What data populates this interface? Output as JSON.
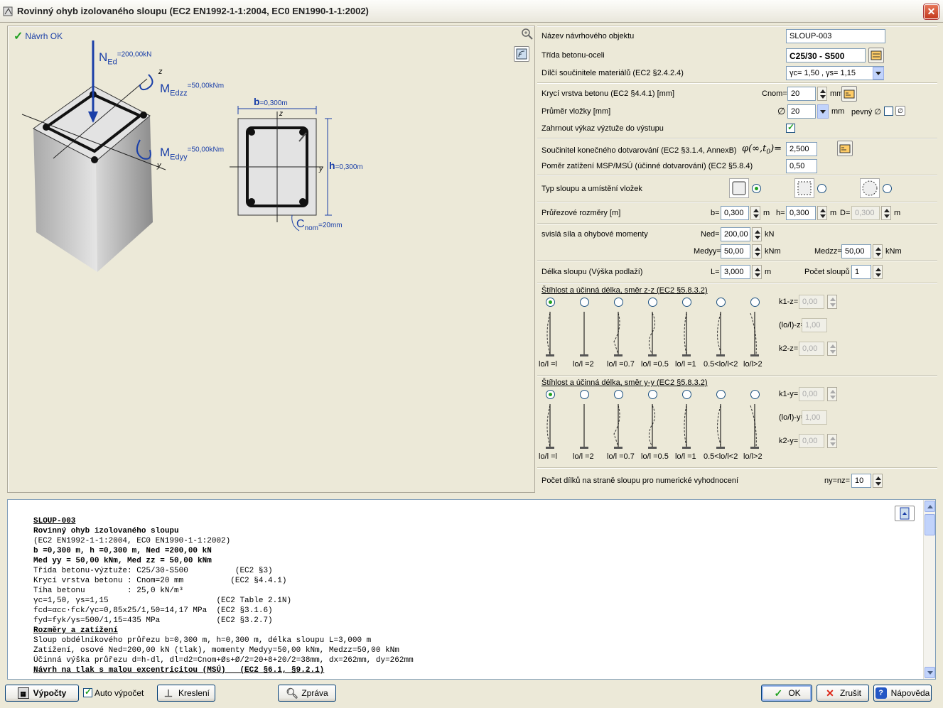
{
  "window": {
    "title": "Rovinný ohyb izolovaného sloupu (EC2 EN1992-1-1:2004, EC0 EN1990-1-1:2002)",
    "close": "✕"
  },
  "drawing": {
    "status": "Návrh OK",
    "ned_label": "N",
    "ned_sub": "Ed",
    "ned_val": "=200,00kN",
    "medzz_label": "M",
    "medzz_sub": "Edzz",
    "medzz_val": "=50,00kNm",
    "medyy_label": "M",
    "medyy_sub": "Edyy",
    "medyy_val": "=50,00kNm",
    "axis_z": "z",
    "axis_y": "y",
    "b_label": "b",
    "b_val": "=0,300m",
    "h_label": "h",
    "h_val": "=0,300m",
    "c_label": "C",
    "c_sub": "nom",
    "c_val": "=20mm"
  },
  "form": {
    "name_label": "Název návrhového objektu",
    "name_value": "SLOUP-003",
    "class_label": "Třída betonu-oceli",
    "class_value": "C25/30 - S500",
    "factors_label": "Dílčí součinitele materiálů (EC2 §2.4.2.4)",
    "factors_value": "γc= 1,50 , γs= 1,15",
    "cover_label": "Krycí vrstva betonu (EC2 §4.4.1) [mm]",
    "cnom_label": "Cnom=",
    "cnom_value": "20",
    "mm": "mm",
    "dia_label": "Průměr vložky [mm]",
    "dia_sym": "∅",
    "dia_value": "20",
    "dia_unit": "mm",
    "fixed_label": "pevný ∅",
    "include_label": "Zahrnout výkaz výztuže do výstupu",
    "creep_label": "Součinitel konečného dotvarování (EC2 §3.1.4, AnnexB)",
    "phi_label": "φ(∞,t",
    "phi_sub": "0",
    "phi_end": ")=",
    "creep_value": "2,500",
    "ratio_label": "Poměr zatížení MSP/MSÚ (účinné dotvarování) (EC2 §5.8.4)",
    "ratio_value": "0,50",
    "type_label": "Typ sloupu a umístění vložek",
    "dims_label": "Průřezové rozměry [m]",
    "b_label": "b=",
    "b_value": "0,300",
    "h_label": "h=",
    "h_value": "0,300",
    "d_label": "D=",
    "d_value": "0,300",
    "m": "m",
    "loads_label": "svislá síla a ohybové momenty",
    "ned_label": "Ned=",
    "ned_value": "200,00",
    "kn": "kN",
    "medyy_label": "Medyy=",
    "medyy_value": "50,00",
    "knm": "kNm",
    "medzz_label": "Medzz=",
    "medzz_value": "50,00",
    "len_label": "Délka sloupu (Výška podlaží)",
    "l_label": "L=",
    "l_value": "3,000",
    "count_label": "Počet sloupů",
    "count_value": "1",
    "slz_title": "Štíhlost a účinná délka, směr  z-z (EC2 §5.8.3.2)",
    "sly_title": "Štíhlost a účinná délka, směr  y-y (EC2 §5.8.3.2)",
    "cases": [
      "lo/l =l",
      "lo/l =2",
      "lo/l =0.7",
      "lo/l =0.5",
      "lo/l =1",
      "0.5<lo/l<2",
      "lo/l>2"
    ],
    "k1z_label": "k1-z=",
    "k1z_value": "0,00",
    "loz_label": "(lo/l)-z=",
    "loz_value": "1,00",
    "k2z_label": "k2-z=",
    "k2z_value": "0,00",
    "k1y_label": "k1-y=",
    "k1y_value": "0,00",
    "loy_label": "(lo/l)-y=",
    "loy_value": "1,00",
    "k2y_label": "k2-y=",
    "k2y_value": "0,00",
    "segments_label": "Počet dílků na straně sloupu pro numerické vyhodnocení",
    "ny_label": "ny=nz=",
    "ny_value": "10"
  },
  "report": [
    {
      "t": "SLOUP-003",
      "s": "u"
    },
    {
      "t": "Rovinný ohyb izolovaného sloupu",
      "s": "b"
    },
    {
      "t": "(EC2 EN1992-1-1:2004, EC0 EN1990-1-1:2002)",
      "s": ""
    },
    {
      "t": "b =0,300 m, h =0,300 m, Ned =200,00 kN",
      "s": "b"
    },
    {
      "t": "Med yy = 50,00 kNm, Med zz = 50,00 kNm",
      "s": "b"
    },
    {
      "t": "Třída betonu-výztuže: C25/30-S500          (EC2 §3)",
      "s": ""
    },
    {
      "t": "Krycí vrstva betonu : Cnom=20 mm          (EC2 §4.4.1)",
      "s": ""
    },
    {
      "t": "Tíha betonu         : 25,0 kN/m³",
      "s": ""
    },
    {
      "t": "γc=1,50, γs=1,15                       (EC2 Table 2.1N)",
      "s": ""
    },
    {
      "t": "fcd=αcc·fck/γc=0,85x25/1,50=14,17 MPa  (EC2 §3.1.6)",
      "s": ""
    },
    {
      "t": "fyd=fyk/γs=500/1,15=435 MPa            (EC2 §3.2.7)",
      "s": ""
    },
    {
      "t": "Rozměry a zatížení",
      "s": "u"
    },
    {
      "t": "Sloup obdélníkového průřezu b=0,300 m, h=0,300 m, délka sloupu L=3,000 m",
      "s": ""
    },
    {
      "t": "Zatížení, osové Ned=200,00 kN (tlak), momenty Medyy=50,00 kNm, Medzz=50,00 kNm",
      "s": ""
    },
    {
      "t": "Účinná výška průřezu d=h-dl, dl=d2=Cnom+Øs+Ø/2=20+8+20/2=38mm, dx=262mm, dy=262mm",
      "s": ""
    },
    {
      "t": "Návrh na tlak s malou excentricitou (MSÚ)   (EC2 §6.1, §9.2.1)",
      "s": "u"
    }
  ],
  "buttons": {
    "calc": "Výpočty",
    "auto": "Auto výpočet",
    "draw": "Kreslení",
    "report": "Zpráva",
    "ok": "OK",
    "cancel": "Zrušit",
    "help": "Nápověda"
  }
}
